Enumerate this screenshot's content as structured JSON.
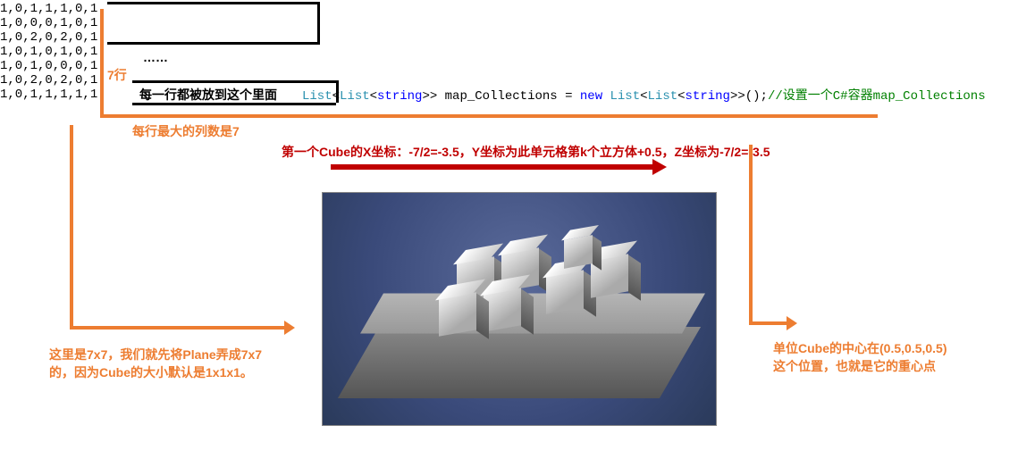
{
  "data_rows": "1,0,1,1,1,0,1\n1,0,0,0,1,0,1\n1,0,2,0,2,0,1\n1,0,1,0,1,0,1\n1,0,1,0,0,0,1\n1,0,2,0,2,0,1\n1,0,1,1,1,1,1",
  "dots": "……",
  "row_label": "7行",
  "row_text": "每一行都被放到这个里面",
  "code": {
    "p1": "List",
    "p2": "<",
    "p3": "List",
    "p4": "<",
    "p5": "string",
    "p6": ">> map_Collections = ",
    "p7": "new ",
    "p8": "List",
    "p9": "<",
    "p10": "List",
    "p11": "<",
    "p12": "string",
    "p13": ">>();",
    "cmt": "//设置一个C#容器map_Collections"
  },
  "col_max": "每行最大的列数是7",
  "cube_text": "第一个Cube的X坐标：-7/2=-3.5，Y坐标为此单元格第k个立方体+0.5，Z坐标为-7/2=-3.5",
  "plane_text_1": "这里是7x7，我们就先将Plane弄成7x7",
  "plane_text_2": "的，因为Cube的大小默认是1x1x1。",
  "cube_center_1": "单位Cube的中心在(0.5,0.5,0.5)",
  "cube_center_2": "这个位置，也就是它的重心点"
}
